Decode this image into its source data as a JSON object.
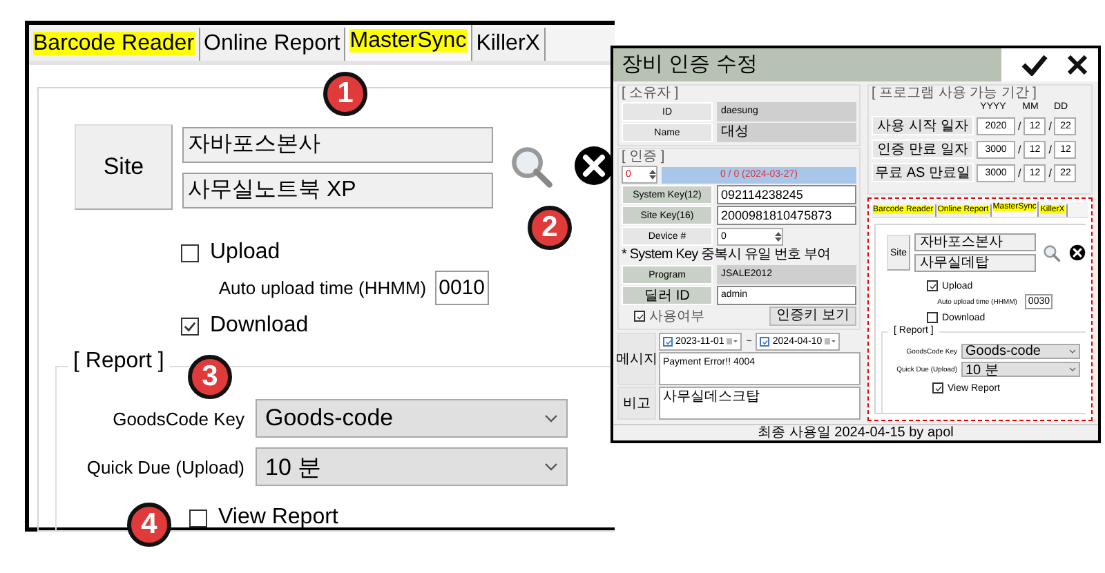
{
  "zoomed_panel": {
    "tabs": [
      {
        "label": "Barcode Reader",
        "highlighted": true,
        "selected": false
      },
      {
        "label": "Online Report",
        "highlighted": false,
        "selected": false
      },
      {
        "label": "MasterSync",
        "highlighted": true,
        "selected": true
      },
      {
        "label": "KillerX",
        "highlighted": false,
        "selected": false
      }
    ],
    "site": {
      "button": "Site",
      "name": "자바포스본사",
      "device": "사무실노트북 XP"
    },
    "upload": {
      "label": "Upload",
      "checked": false
    },
    "auto_upload": {
      "label": "Auto upload time (HHMM)",
      "value": "0010"
    },
    "download": {
      "label": "Download",
      "checked": true
    },
    "report": {
      "title": "[ Report ]",
      "goodscode": {
        "label": "GoodsCode Key",
        "value": "Goods-code"
      },
      "quick_due": {
        "label": "Quick Due (Upload)",
        "value": "10 분"
      },
      "view_report": {
        "label": "View Report",
        "checked": false
      }
    }
  },
  "callouts": [
    "1",
    "2",
    "3",
    "4"
  ],
  "dialog": {
    "title": "장비 인증 수정",
    "owner": {
      "title": "[ 소유자 ]",
      "fields": [
        {
          "label": "ID",
          "value": "daesung"
        },
        {
          "label": "Name",
          "value": "대성"
        }
      ]
    },
    "period": {
      "title": "[ 프로그램 사용 가능 기간 ]",
      "headers": [
        "YYYY",
        "MM",
        "DD"
      ],
      "rows": [
        {
          "label": "사용 시작 일자",
          "values": [
            "2020",
            "12",
            "22"
          ],
          "separators": [
            "/",
            "/"
          ]
        },
        {
          "label": "인증 만료 일자",
          "values": [
            "3000",
            "12",
            "12"
          ],
          "separators": [
            "/",
            "/"
          ]
        },
        {
          "label": "무료 AS 만료일",
          "values": [
            "3000",
            "12",
            "22"
          ],
          "separators": [
            "/",
            "/"
          ]
        }
      ]
    },
    "auth": {
      "title": "[ 인증 ]",
      "counter": "0",
      "status": "0 / 0 (2024-03-27)",
      "fields": [
        {
          "label": "System Key(12)",
          "value": "092114238245"
        },
        {
          "label": "Site Key(16)",
          "value": "2000981810475873"
        }
      ],
      "device": {
        "label": "Device #",
        "value": "0"
      },
      "note": "* System Key 중복시 유일 번호 부여",
      "program": {
        "label": "Program",
        "value": "JSALE2012"
      },
      "dealer": {
        "label": "딜러 ID",
        "value": "admin"
      },
      "in_use": {
        "label": "사용여부",
        "checked": true
      },
      "view_key_button": "인증키 보기"
    },
    "message": {
      "label": "메시지",
      "from": {
        "date": "2023-11-01",
        "checked": true
      },
      "tilde": "~",
      "to": {
        "date": "2024-04-10",
        "checked": true
      },
      "text": "Payment Error!! 4004"
    },
    "remark": {
      "label": "비고",
      "text": "사무실데스크탑"
    },
    "embedded_panel": {
      "tabs": [
        {
          "label": "Barcode Reader",
          "highlighted": true,
          "selected": false
        },
        {
          "label": "Online Report",
          "highlighted": true,
          "selected": false
        },
        {
          "label": "MasterSync",
          "highlighted": true,
          "selected": true
        },
        {
          "label": "KillerX",
          "highlighted": true,
          "selected": false
        }
      ],
      "site": {
        "button": "Site",
        "name": "자바포스본사",
        "device": "사무실데탑"
      },
      "upload": {
        "label": "Upload",
        "checked": true
      },
      "auto_upload": {
        "label": "Auto upload time (HHMM)",
        "value": "0030"
      },
      "download": {
        "label": "Download",
        "checked": false
      },
      "report": {
        "title": "[ Report ]",
        "goodscode": {
          "label": "GoodsCode Key",
          "value": "Goods-code"
        },
        "quick_due": {
          "label": "Quick Due (Upload)",
          "value": "10 분"
        },
        "view_report": {
          "label": "View Report",
          "checked": true
        }
      }
    },
    "footer": "최종 사용일 2024-04-15 by apol"
  }
}
